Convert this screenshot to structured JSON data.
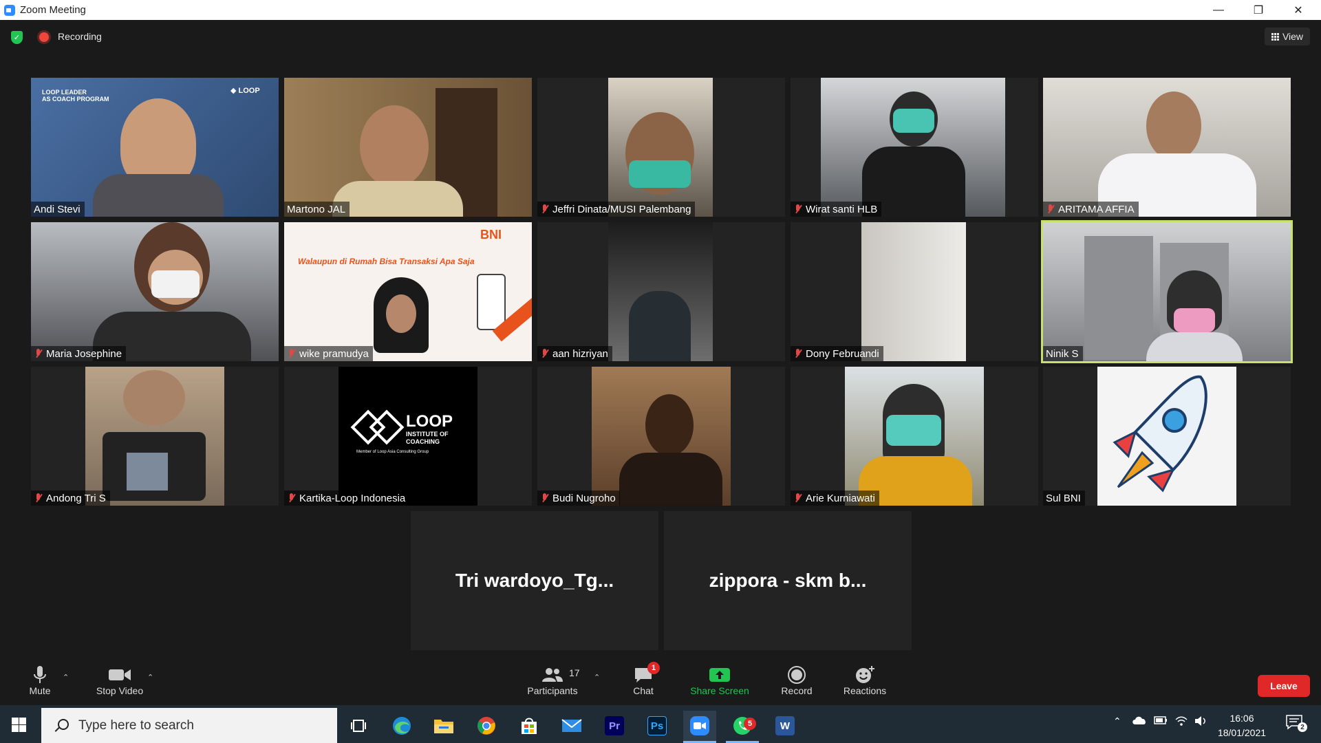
{
  "window": {
    "title": "Zoom Meeting"
  },
  "meeting": {
    "recording_label": "Recording",
    "view_label": "View",
    "participants": [
      {
        "name": "Andi Stevi",
        "muted": false
      },
      {
        "name": "Martono JAL",
        "muted": false
      },
      {
        "name": "Jeffri Dinata/MUSI Palembang",
        "muted": true
      },
      {
        "name": "Wirat santi HLB",
        "muted": true
      },
      {
        "name": "ARITAMA AFFIA",
        "muted": true
      },
      {
        "name": "Maria Josephine",
        "muted": true
      },
      {
        "name": "wike pramudya",
        "muted": true
      },
      {
        "name": "aan hizriyan",
        "muted": true
      },
      {
        "name": "Dony Februandi",
        "muted": true
      },
      {
        "name": "Ninik S",
        "muted": false,
        "active_speaker": true
      },
      {
        "name": "Andong Tri S",
        "muted": true
      },
      {
        "name": "Kartika-Loop Indonesia",
        "muted": true
      },
      {
        "name": "Budi Nugroho",
        "muted": true
      },
      {
        "name": "Arie Kurniawati",
        "muted": true
      },
      {
        "name": "Sul BNI",
        "muted": false
      }
    ],
    "video_off_participants": [
      {
        "name": "Tri  wardoyo_Tg..."
      },
      {
        "name": "zippora - skm b..."
      }
    ],
    "tile_backgrounds": {
      "andi": "#3d5a86",
      "martono": "#8a6b45",
      "jeffri": "#6e655c",
      "wirat": "#8b8d90",
      "aritama": "#c9c6c0",
      "maria": "#7b7d82",
      "wike": "#f7f2ee",
      "aan": "#3a3a3a",
      "dony": "#d8d5cf",
      "ninik": "#a3a4a6",
      "andong": "#9c8a78",
      "kartika": "#000000",
      "budi": "#8c6a4c",
      "arie": "#b9b29a",
      "sul": "#f2f2f2"
    },
    "loop_logo": {
      "title": "LOOP",
      "line1": "INSTITUTE OF",
      "line2": "COACHING",
      "line3": "Member of Loop Asia Consulting Group"
    },
    "bni_slide": {
      "brand": "BNI",
      "headline": "Walaupun di Rumah Bisa Transaksi Apa Saja"
    }
  },
  "toolbar": {
    "mute_label": "Mute",
    "stop_video_label": "Stop Video",
    "participants_label": "Participants",
    "participants_count": "17",
    "chat_label": "Chat",
    "chat_badge": "1",
    "share_screen_label": "Share Screen",
    "record_label": "Record",
    "reactions_label": "Reactions",
    "leave_label": "Leave"
  },
  "taskbar": {
    "search_placeholder": "Type here to search",
    "time": "16:06",
    "date": "18/01/2021",
    "whatsapp_badge": "5",
    "notification_count": "2",
    "apps": [
      "task-view",
      "edge",
      "file-explorer",
      "chrome",
      "store",
      "mail",
      "premiere-pro",
      "photoshop",
      "zoom",
      "whatsapp",
      "word"
    ]
  },
  "colors": {
    "accent": "#2d8cff",
    "active_speaker": "#c7e16a",
    "leave": "#e02828",
    "share_green": "#23c552",
    "muted_red": "#e04848"
  }
}
